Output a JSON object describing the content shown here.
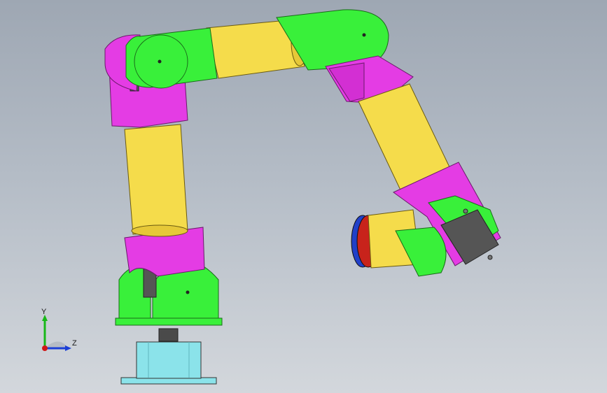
{
  "viewport": {
    "title": "",
    "background_top": "#9ea7b3",
    "background_bottom": "#d3d7dc"
  },
  "model": {
    "colors": {
      "link": "#f5dc4b",
      "joint_housing": "#39f03a",
      "bracket": "#e43ce4",
      "servo": "#555555",
      "base_mount": "#8be3ea",
      "gripper_disc_red": "#c8231b",
      "gripper_disc_blue": "#2140c8"
    }
  },
  "triad": {
    "y_label": "Y",
    "z_label": "Z",
    "icon": "coordinate-triad-icon",
    "y_color": "#18b818",
    "z_color": "#1c3fd6",
    "x_color": "#d01818"
  }
}
